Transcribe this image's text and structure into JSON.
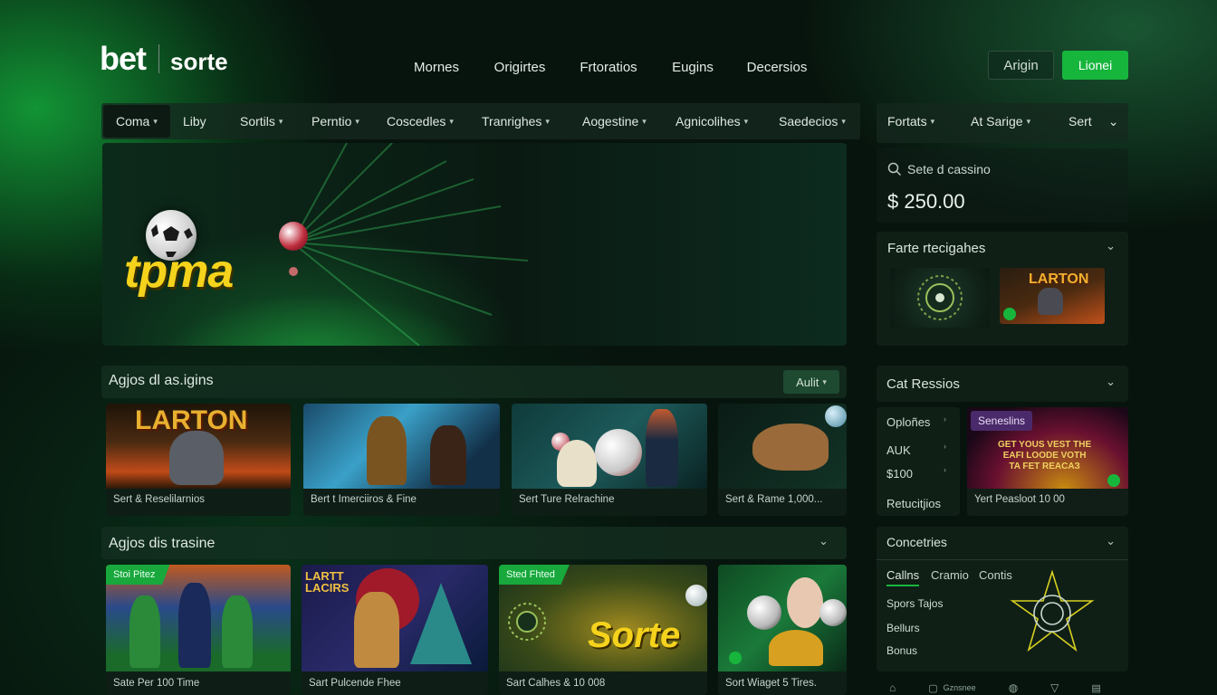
{
  "brand": {
    "bet": "bet",
    "sorte": "sorte"
  },
  "topnav": [
    "Mornes",
    "Origirtes",
    "Frtoratios",
    "Eugins",
    "Decersios"
  ],
  "auth": {
    "login": "Arigin",
    "register": "Lionei"
  },
  "categories": [
    {
      "label": "Coma",
      "caret": true
    },
    {
      "label": "Liby",
      "caret": false
    },
    {
      "label": "Sortils",
      "caret": true
    },
    {
      "label": "Perntio",
      "caret": true
    },
    {
      "label": "Coscedles",
      "caret": true
    },
    {
      "label": "Tranrighes",
      "caret": true
    },
    {
      "label": "Aogestine",
      "caret": true
    },
    {
      "label": "Agnicolihes",
      "caret": true
    },
    {
      "label": "Saedecios",
      "caret": true
    }
  ],
  "sort": {
    "a": "Fortats",
    "b": "At Sarige",
    "c": "Sert"
  },
  "hero": {
    "title": "tpma"
  },
  "search": {
    "label": "Sete d cassino",
    "amount": "$ 250.00"
  },
  "panel_featured": {
    "title": "Farte rtecigahes",
    "thumb2": "LARTON"
  },
  "section1": {
    "title": "Agjos dl as.igins",
    "action": "Aulit",
    "cards": [
      {
        "caption": "Sert & Reselilarnios",
        "art": "LARTON"
      },
      {
        "caption": "Bert t Imerciiros & Fine"
      },
      {
        "caption": "Sert Ture Relrachine"
      },
      {
        "caption": "Sert & Rame 1,000..."
      }
    ]
  },
  "section2": {
    "title": "Agjos dis trasine",
    "cards": [
      {
        "caption": "Sate Per 100 Time",
        "tag": "Stoi Pitez"
      },
      {
        "caption": "Sart Pulcende Fhee",
        "art": "LARTT LACIRS"
      },
      {
        "caption": "Sart Calhes & 10 008",
        "tag": "Sted Fhted",
        "art": "Sorte"
      },
      {
        "caption": "Sort Wiaget 5 Tires."
      }
    ]
  },
  "panel_casino": {
    "title": "Cat Ressios",
    "items": [
      "Oploñes",
      "AUK",
      "$100",
      "Retucitjios"
    ],
    "badge": "Seneslins",
    "promo_line1": "GET YOUS VEST THE",
    "promo_line2": "EAFI LOODE VOTH",
    "promo_line3": "TA FET REACAЗ",
    "caption": "Yert Peasloot 10 00"
  },
  "panel_contacts": {
    "title": "Concetries",
    "tabs": [
      "Callns",
      "Cramio",
      "Contis"
    ],
    "items": [
      "Spors Tajos",
      "Bellurs",
      "Bonus"
    ]
  },
  "footer_icons": [
    "home-icon",
    "grid-icon",
    "mic-icon",
    "filter-icon",
    "book-icon"
  ],
  "footer_label": "Gznsnee"
}
